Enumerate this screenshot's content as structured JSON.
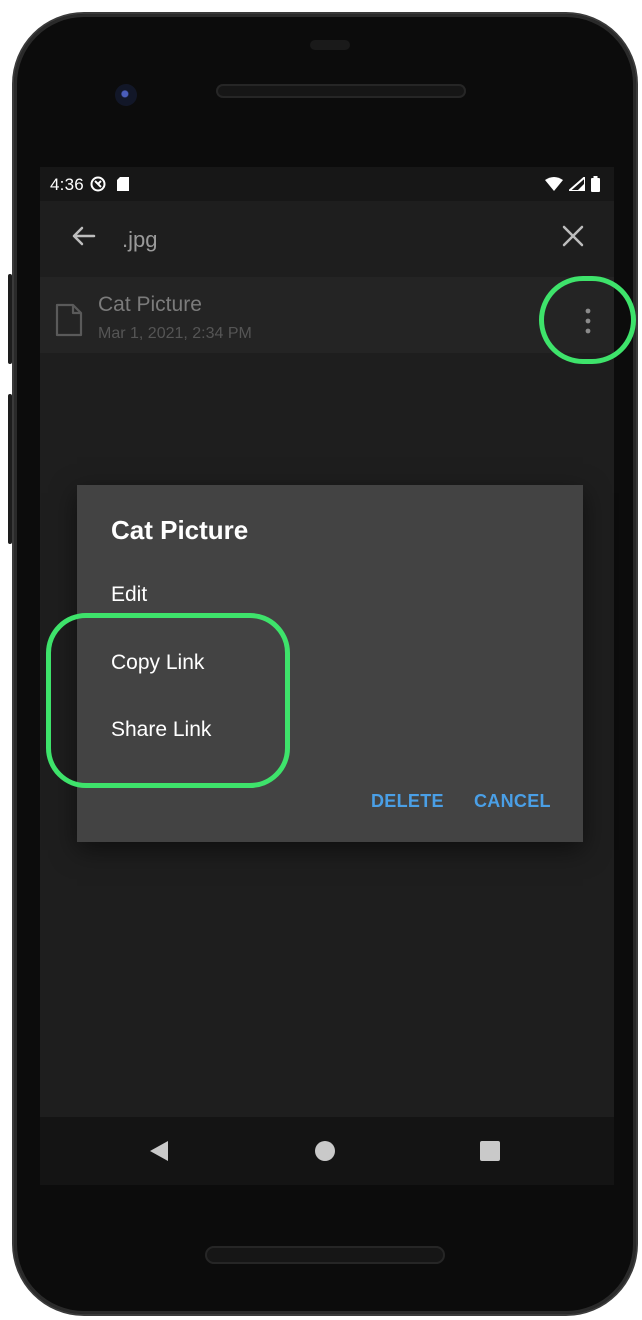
{
  "status_bar": {
    "time": "4:36",
    "icons_left": [
      "sync-icon",
      "sd-card-icon"
    ],
    "icons_right": [
      "wifi-icon",
      "signal-icon",
      "battery-icon"
    ]
  },
  "toolbar": {
    "search_query": ".jpg",
    "back_icon": "arrow-left-icon",
    "close_icon": "close-icon"
  },
  "file": {
    "name": "Cat Picture",
    "date": "Mar 1, 2021, 2:34 PM",
    "menu_icon": "more-vert-icon"
  },
  "dialog": {
    "title": "Cat Picture",
    "items": [
      {
        "label": "Edit"
      },
      {
        "label": "Copy Link"
      },
      {
        "label": "Share Link"
      }
    ],
    "buttons": {
      "delete": "DELETE",
      "cancel": "CANCEL"
    }
  },
  "colors": {
    "accent": "#4a9fe6",
    "highlight": "#3ee36b",
    "dialog_bg": "#434343",
    "screen_bg": "#1e1e1e"
  }
}
